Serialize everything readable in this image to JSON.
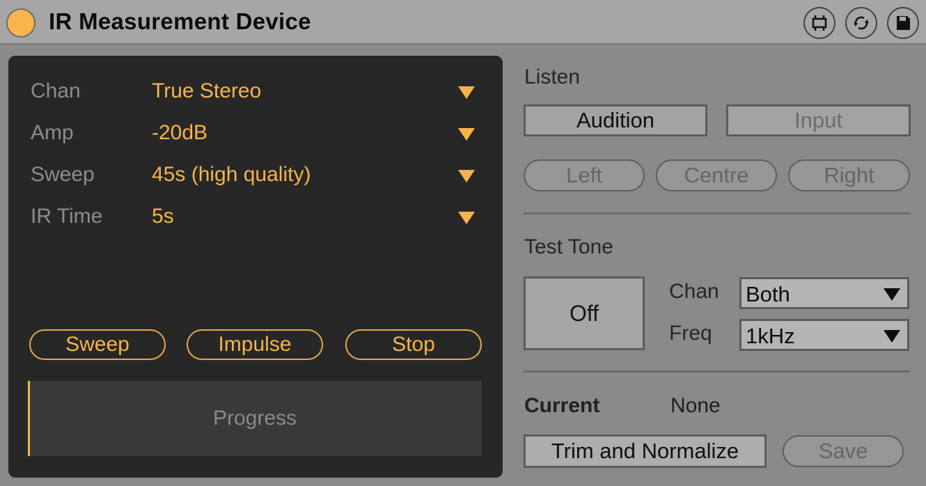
{
  "window": {
    "title": "IR Measurement Device",
    "power_color": "#f9b54c",
    "header_icons": [
      "freeze-device-icon",
      "refresh-icon",
      "save-disk-icon"
    ]
  },
  "measurement": {
    "params": [
      {
        "label": "Chan",
        "value": "True Stereo"
      },
      {
        "label": "Amp",
        "value": "-20dB"
      },
      {
        "label": "Sweep",
        "value": "45s (high quality)"
      },
      {
        "label": "IR Time",
        "value": "5s"
      }
    ],
    "buttons": {
      "sweep": "Sweep",
      "impulse": "Impulse",
      "stop": "Stop"
    },
    "progress": {
      "label": "Progress",
      "fraction": 0.0
    },
    "accent_color": "#f6b34b"
  },
  "listen": {
    "heading": "Listen",
    "audition_label": "Audition",
    "input_label": "Input",
    "channels": [
      "Left",
      "Centre",
      "Right"
    ]
  },
  "test_tone": {
    "heading": "Test Tone",
    "toggle_label": "Off",
    "chan_label": "Chan",
    "chan_value": "Both",
    "freq_label": "Freq",
    "freq_value": "1kHz"
  },
  "current": {
    "label": "Current",
    "value": "None",
    "trim_label": "Trim and Normalize",
    "save_label": "Save"
  }
}
